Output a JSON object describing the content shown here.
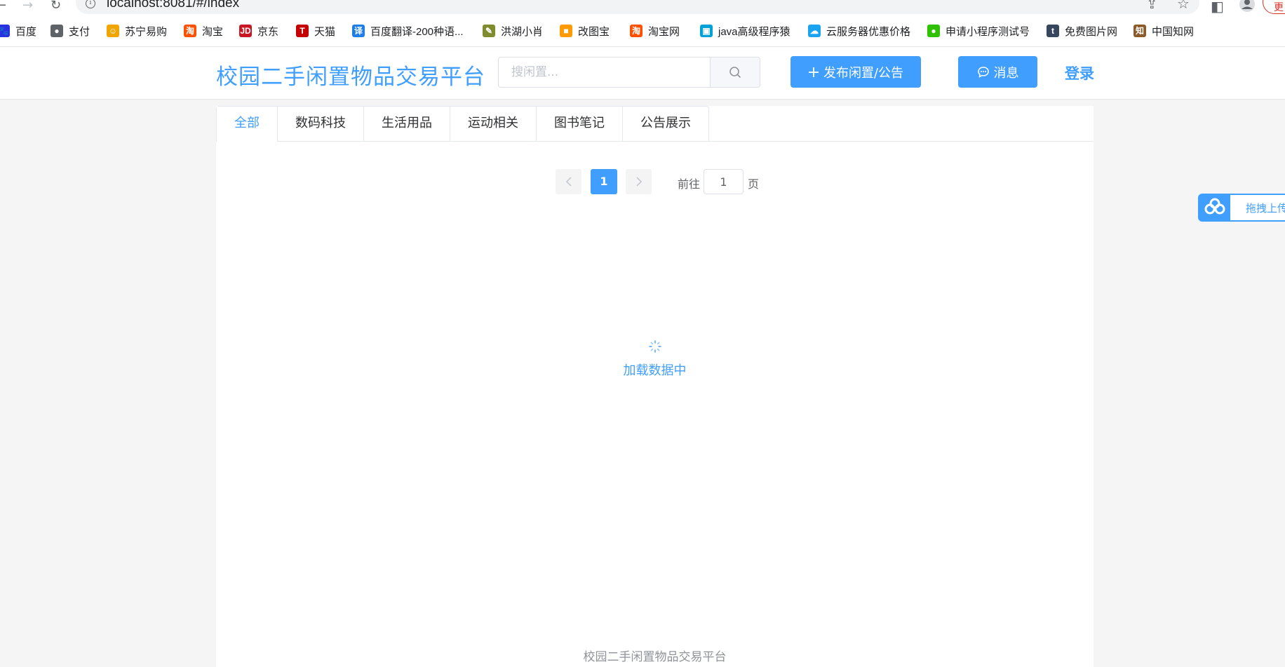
{
  "browser": {
    "url": "localhost:8081/#/index",
    "update_label": "更",
    "bookmarks": [
      {
        "label": "百度",
        "icon": "baidu-paw-icon",
        "color": "#2932e1"
      },
      {
        "label": "支付",
        "icon": "globe-icon",
        "color": "#5f6368"
      },
      {
        "label": "苏宁易购",
        "icon": "suning-lion-icon",
        "color": "#f0a500"
      },
      {
        "label": "淘宝",
        "icon": "taobao-icon",
        "color": "#ff5000"
      },
      {
        "label": "京东",
        "icon": "jd-icon",
        "color": "#c91623"
      },
      {
        "label": "天猫",
        "icon": "tmall-icon",
        "color": "#c40000"
      },
      {
        "label": "百度翻译-200种语...",
        "icon": "translate-icon",
        "color": "#1f7de8"
      },
      {
        "label": "洪湖小肖",
        "icon": "bird-icon",
        "color": "#7f8c2d"
      },
      {
        "label": "改图宝",
        "icon": "gaitubao-icon",
        "color": "#ff9a00"
      },
      {
        "label": "淘宝网",
        "icon": "taobao-icon",
        "color": "#ff5000"
      },
      {
        "label": "java高级程序猿",
        "icon": "bilibili-icon",
        "color": "#00a1d6"
      },
      {
        "label": "云服务器优惠价格",
        "icon": "cloud-icon",
        "color": "#1aa4f0"
      },
      {
        "label": "申请小程序测试号",
        "icon": "wechat-icon",
        "color": "#2dc100"
      },
      {
        "label": "免费图片网",
        "icon": "tumblr-icon",
        "color": "#36465d"
      },
      {
        "label": "中国知网",
        "icon": "cnki-icon",
        "color": "#8a5a2b"
      }
    ]
  },
  "header": {
    "title": "校园二手闲置物品交易平台",
    "search_placeholder": "搜闲置...",
    "publish_label": "发布闲置/公告",
    "message_label": "消息",
    "login_label": "登录"
  },
  "tabs": [
    {
      "label": "全部",
      "active": true
    },
    {
      "label": "数码科技",
      "active": false
    },
    {
      "label": "生活用品",
      "active": false
    },
    {
      "label": "运动相关",
      "active": false
    },
    {
      "label": "图书笔记",
      "active": false
    },
    {
      "label": "公告展示",
      "active": false
    }
  ],
  "pagination": {
    "current_page": "1",
    "goto_label": "前往",
    "goto_value": "1",
    "page_suffix": "页"
  },
  "loading_text": "加载数据中",
  "footer_text": "校园二手闲置物品交易平台",
  "float_widget": {
    "label": "拖拽上传"
  },
  "colors": {
    "primary": "#409eff",
    "background": "#f5f5f5"
  }
}
